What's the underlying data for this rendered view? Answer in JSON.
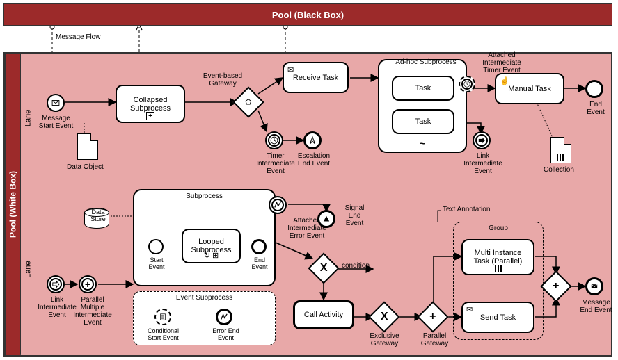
{
  "blackBoxTitle": "Pool (Black Box)",
  "whiteBoxTitle": "Pool (White Box)",
  "messageFlowLabel": "Message Flow",
  "lane1": {
    "title": "Lane",
    "msgStart": "Message\nStart Event",
    "collapsedSub": "Collapsed\nSubprocess",
    "dataObject": "Data Object",
    "eventGateway": "Event-based\nGateway",
    "receiveTask": "Receive Task",
    "timerInter": "Timer\nIntermediate\nEvent",
    "escalationEnd": "Escalation\nEnd Event",
    "adhoc": "Ad-hoc Subprocess",
    "task1": "Task",
    "task2": "Task",
    "attachedTimer": "Attached\nIntermediate\nTimer Event",
    "manualTask": "Manual Task",
    "linkInter": "Link\nIntermediate\nEvent",
    "endEvent": "End\nEvent",
    "collection": "Collection"
  },
  "lane2": {
    "title": "Lane",
    "linkInter": "Link\nIntermediate\nEvent",
    "parallelMulti": "Parallel\nMultiple\nIntermediate\nEvent",
    "dataStore": "Data\nStore",
    "subprocess": "Subprocess",
    "startEvent": "Start\nEvent",
    "loopedSub": "Looped\nSubprocess",
    "endEv": "End\nEvent",
    "eventSub": "Event Subprocess",
    "condStart": "Conditional\nStart Event",
    "errorEnd": "Error End\nEvent",
    "attachedError": "Attached\nIntermediate\nError Event",
    "signalEnd": "Signal\nEnd\nEvent",
    "condition": "condition",
    "callActivity": "Call Activity",
    "exclusiveGw": "Exclusive\nGateway",
    "parallelGw": "Parallel\nGateway",
    "textAnnot": "Text Annotation",
    "group": "Group",
    "multiInstance": "Multi Instance\nTask (Parallel)",
    "sendTask": "Send Task",
    "msgEnd": "Message\nEnd Event"
  }
}
